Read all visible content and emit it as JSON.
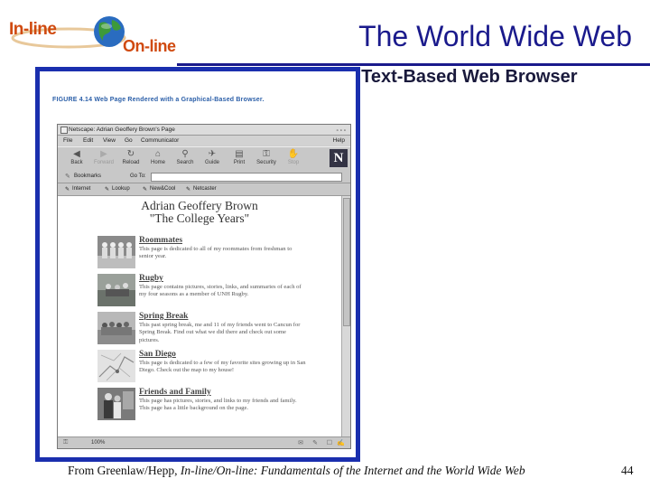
{
  "logo": {
    "part1": "In-line",
    "part2": "On-line"
  },
  "slide": {
    "title": "The World Wide Web",
    "subtitle": "Lynx: Text-Based Web Browser",
    "footer_prefix": "From Greenlaw/Hepp, ",
    "footer_italic": "In-line/On-line: Fundamentals of the Internet and the World Wide Web",
    "page_number": "44"
  },
  "figure": {
    "caption": "FIGURE 4.14  Web Page Rendered with a Graphical-Based Browser."
  },
  "browser": {
    "window_title": "Netscape: Adrian Geoffery Brown's Page",
    "menu": [
      "File",
      "Edit",
      "View",
      "Go",
      "Communicator"
    ],
    "help": "Help",
    "toolbar": [
      {
        "label": "Back",
        "icon": "back-arrow-icon",
        "glyph": "◀"
      },
      {
        "label": "Forward",
        "icon": "forward-arrow-icon",
        "glyph": "▶"
      },
      {
        "label": "Reload",
        "icon": "reload-icon",
        "glyph": "↻"
      },
      {
        "label": "Home",
        "icon": "home-icon",
        "glyph": "⌂"
      },
      {
        "label": "Search",
        "icon": "search-icon",
        "glyph": "⚲"
      },
      {
        "label": "Guide",
        "icon": "guide-icon",
        "glyph": "✈"
      },
      {
        "label": "Print",
        "icon": "print-icon",
        "glyph": "▤"
      },
      {
        "label": "Security",
        "icon": "security-icon",
        "glyph": "⚿"
      },
      {
        "label": "Stop",
        "icon": "stop-icon",
        "glyph": "✋"
      }
    ],
    "logo_letter": "N",
    "bookmarks_label": "Bookmarks",
    "goto_label": "Go To:",
    "url_value": "",
    "personal": [
      "Internet",
      "Lookup",
      "New&Cool",
      "Netcaster"
    ],
    "status_zoom": "100%"
  },
  "page": {
    "name": "Adrian Geoffery Brown",
    "subtitle": "\"The College Years\"",
    "entries": [
      {
        "title": "Roommates",
        "desc": "This page is dedicated to all of my roommates from freshman to senior year."
      },
      {
        "title": "Rugby",
        "desc": "This page contains pictures, stories, links, and summaries of each of my four seasons as a member of UNH Rugby."
      },
      {
        "title": "Spring Break",
        "desc": "This past spring break, me and 11 of my friends went to Cancun for Spring Break. Find out what we did there and check out some pictures."
      },
      {
        "title": "San Diego",
        "desc": "This page is dedicated to a few of my favorite sites growing up in San Diego. Check out the map to my house!"
      },
      {
        "title": "Friends and Family",
        "desc": "This page has pictures, stories, and links to my friends and family. This page has a little background on the page."
      }
    ]
  },
  "colors": {
    "title_blue": "#1a1a8c",
    "frame_blue": "#1a2fae",
    "logo_orange": "#d04a10"
  }
}
